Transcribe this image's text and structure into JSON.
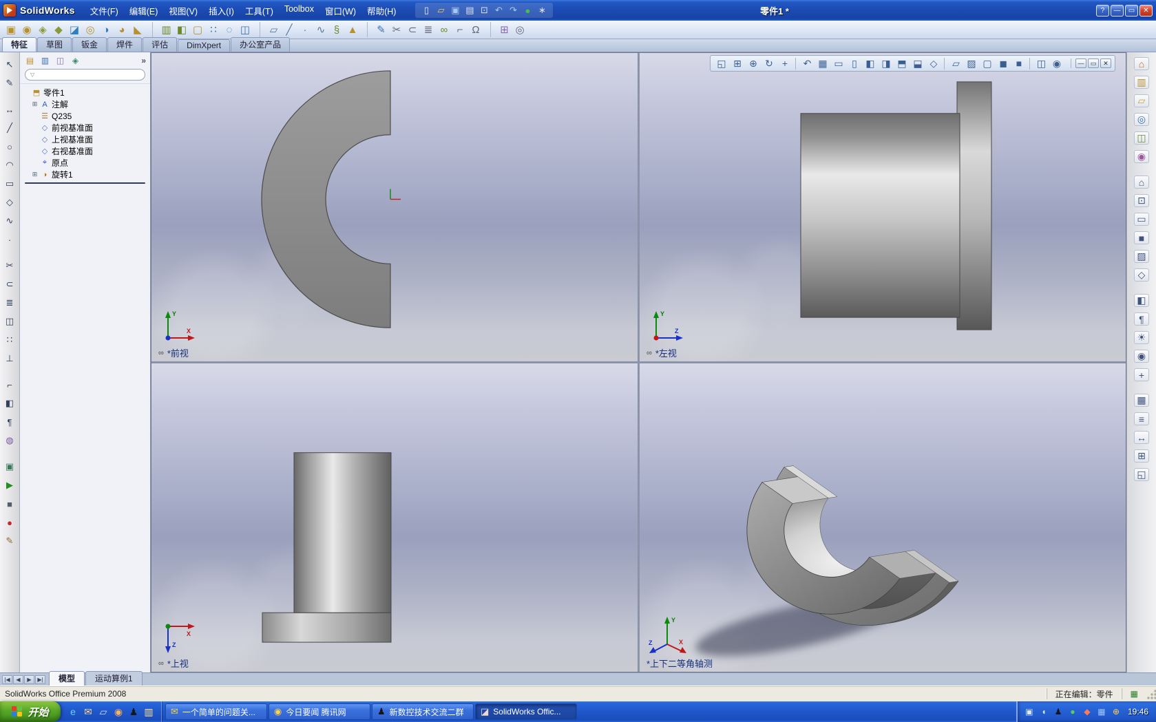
{
  "titlebar": {
    "app_name": "SolidWorks",
    "doc_title": "零件1 *",
    "help_btn": "?",
    "min_btn": "—",
    "max_btn": "▭",
    "close_btn": "✕"
  },
  "menubar": {
    "items": [
      "文件(F)",
      "编辑(E)",
      "视图(V)",
      "插入(I)",
      "工具(T)",
      "Toolbox",
      "窗口(W)",
      "帮助(H)"
    ]
  },
  "quick_icons": [
    {
      "n": "new-document-icon",
      "g": "▯",
      "c": "#eef3fc"
    },
    {
      "n": "open-document-icon",
      "g": "▱",
      "c": "#f0cc5a"
    },
    {
      "n": "save-icon",
      "g": "▣",
      "c": "#a8c8f0"
    },
    {
      "n": "print-icon",
      "g": "▤",
      "c": "#dce2f0"
    },
    {
      "n": "copy-icon",
      "g": "⊡",
      "c": "#dce2f0"
    },
    {
      "n": "undo-icon",
      "g": "↶",
      "c": "#a8c8f0"
    },
    {
      "n": "redo-icon",
      "g": "↷",
      "c": "#a8c8f0"
    },
    {
      "n": "rebuild-icon",
      "g": "●",
      "c": "#46c046"
    },
    {
      "n": "options-icon",
      "g": "∗",
      "c": "#dce2f0"
    }
  ],
  "toolbar": {
    "icons": [
      {
        "n": "extruded-boss-icon",
        "g": "▣",
        "c": "#b8912f"
      },
      {
        "n": "revolved-boss-icon",
        "g": "◉",
        "c": "#b8912f"
      },
      {
        "n": "swept-boss-icon",
        "g": "◈",
        "c": "#8a9a3a"
      },
      {
        "n": "lofted-boss-icon",
        "g": "◆",
        "c": "#8a9a3a"
      },
      {
        "n": "extruded-cut-icon",
        "g": "◪",
        "c": "#2f7fc0"
      },
      {
        "n": "hole-wizard-icon",
        "g": "◎",
        "c": "#b8912f"
      },
      {
        "n": "revolved-cut-icon",
        "g": "◑",
        "c": "#2f7fc0"
      },
      {
        "n": "fillet-icon",
        "g": "◕",
        "c": "#b8912f"
      },
      {
        "n": "chamfer-icon",
        "g": "◣",
        "c": "#b8912f"
      },
      {
        "n": "rib-icon",
        "g": "▥",
        "c": "#6a8a2a",
        "gap": true
      },
      {
        "n": "draft-icon",
        "g": "◧",
        "c": "#6a8a2a"
      },
      {
        "n": "shell-icon",
        "g": "▢",
        "c": "#b8912f"
      },
      {
        "n": "linear-pattern-icon",
        "g": "∷",
        "c": "#3a6fb0"
      },
      {
        "n": "circular-pattern-icon",
        "g": "◌",
        "c": "#3a6fb0"
      },
      {
        "n": "mirror-icon",
        "g": "◫",
        "c": "#3a6fb0"
      },
      {
        "n": "reference-plane-icon",
        "g": "▱",
        "c": "#557799",
        "gap": true
      },
      {
        "n": "axis-icon",
        "g": "╱",
        "c": "#557799"
      },
      {
        "n": "point-icon",
        "g": "·",
        "c": "#557799"
      },
      {
        "n": "curve-icon",
        "g": "∿",
        "c": "#557799"
      },
      {
        "n": "helix-icon",
        "g": "§",
        "c": "#6a8a2a"
      },
      {
        "n": "instant3d-icon",
        "g": "▲",
        "c": "#b8912f"
      },
      {
        "n": "sketch-icon",
        "g": "✎",
        "c": "#3a6fb0",
        "gap": true
      },
      {
        "n": "trim-icon",
        "g": "✂",
        "c": "#667"
      },
      {
        "n": "convert-entities-icon",
        "g": "⊂",
        "c": "#667"
      },
      {
        "n": "offset-entities-icon",
        "g": "≣",
        "c": "#667"
      },
      {
        "n": "mate-icon",
        "g": "∞",
        "c": "#6a8a2a"
      },
      {
        "n": "measure-icon",
        "g": "⌐",
        "c": "#667"
      },
      {
        "n": "mass-properties-icon",
        "g": "Ω",
        "c": "#667"
      },
      {
        "n": "toolbox-icon",
        "g": "⊞",
        "c": "#8a6aae",
        "gap": true
      },
      {
        "n": "search-icon",
        "g": "◎",
        "c": "#667"
      }
    ]
  },
  "command_tabs": {
    "items": [
      "特征",
      "草图",
      "钣金",
      "焊件",
      "评估",
      "DimXpert",
      "办公室产品"
    ]
  },
  "left_rail": [
    {
      "n": "select-arrow-icon",
      "g": "↖",
      "c": "#33415c"
    },
    {
      "n": "sketch-pencil-icon",
      "g": "✎",
      "c": "#33415c"
    },
    {
      "n": "dimension-icon",
      "g": "↔",
      "c": "#33415c",
      "gap": true
    },
    {
      "n": "line-icon",
      "g": "╱",
      "c": "#33415c"
    },
    {
      "n": "circle-icon",
      "g": "○",
      "c": "#33415c"
    },
    {
      "n": "arc-icon",
      "g": "◠",
      "c": "#33415c"
    },
    {
      "n": "rectangle-icon",
      "g": "▭",
      "c": "#33415c"
    },
    {
      "n": "polygon-icon",
      "g": "◇",
      "c": "#33415c"
    },
    {
      "n": "spline-icon",
      "g": "∿",
      "c": "#33415c"
    },
    {
      "n": "point-sketch-icon",
      "g": "·",
      "c": "#33415c"
    },
    {
      "n": "trim-entities-icon",
      "g": "✂",
      "c": "#33415c",
      "gap": true
    },
    {
      "n": "convert-icon",
      "g": "⊂",
      "c": "#33415c"
    },
    {
      "n": "offset-icon",
      "g": "≣",
      "c": "#33415c"
    },
    {
      "n": "mirror-sketch-icon",
      "g": "◫",
      "c": "#33415c"
    },
    {
      "n": "pattern-sketch-icon",
      "g": "∷",
      "c": "#33415c"
    },
    {
      "n": "relations-icon",
      "g": "⊥",
      "c": "#33415c"
    },
    {
      "n": "measure-tool-icon",
      "g": "⌐",
      "c": "#33415c",
      "gap": true
    },
    {
      "n": "section-tool-icon",
      "g": "◧",
      "c": "#33415c"
    },
    {
      "n": "annotation-icon",
      "g": "¶",
      "c": "#33415c"
    },
    {
      "n": "appearance-icon",
      "g": "◍",
      "c": "#7a5aa0"
    },
    {
      "n": "scene-icon",
      "g": "▣",
      "c": "#3a7a5a",
      "gap": true
    },
    {
      "n": "play-icon",
      "g": "▶",
      "c": "#1f8f1f"
    },
    {
      "n": "stop-icon",
      "g": "■",
      "c": "#555e6e"
    },
    {
      "n": "record-icon",
      "g": "●",
      "c": "#c22828"
    },
    {
      "n": "edit-feature-icon",
      "g": "✎",
      "c": "#8a6a2a"
    }
  ],
  "fpanel": {
    "collapse": "»",
    "filter_glyph": "▽",
    "filter_value": "",
    "tabs": [
      {
        "n": "featuremanager-tree-icon",
        "g": "▤",
        "c": "#b8912f"
      },
      {
        "n": "propertymanager-icon",
        "g": "▥",
        "c": "#3a6fb0"
      },
      {
        "n": "configurationmanager-icon",
        "g": "◫",
        "c": "#8a6aae"
      },
      {
        "n": "dimxpertmanager-icon",
        "g": "◈",
        "c": "#3a8a6a"
      }
    ]
  },
  "feature_tree": {
    "root": {
      "label": "零件1",
      "glyph": "⬒",
      "color": "#b8912f",
      "expand": ""
    },
    "items": [
      {
        "label": "注解",
        "glyph": "A",
        "color": "#1f5fbf",
        "expand": "⊞"
      },
      {
        "label": "Q235",
        "glyph": "☰",
        "color": "#9a7b2d",
        "expand": ""
      },
      {
        "label": "前视基准面",
        "glyph": "◇",
        "color": "#5577bb",
        "expand": ""
      },
      {
        "label": "上视基准面",
        "glyph": "◇",
        "color": "#5577bb",
        "expand": ""
      },
      {
        "label": "右视基准面",
        "glyph": "◇",
        "color": "#5577bb",
        "expand": ""
      },
      {
        "label": "原点",
        "glyph": "⌖",
        "color": "#2b4fd0",
        "expand": ""
      },
      {
        "label": "旋转1",
        "glyph": "◑",
        "color": "#c07820",
        "expand": "⊞"
      }
    ]
  },
  "viewports": {
    "label_icon": "∞",
    "front": {
      "label": "*前视"
    },
    "left": {
      "label": "*左视"
    },
    "top": {
      "label": "*上视"
    },
    "iso": {
      "label": "*上下二等角轴测"
    }
  },
  "axes": {
    "x": "X",
    "y": "Y",
    "z": "Z"
  },
  "view_toolbar": {
    "icons": [
      {
        "n": "zoom-to-fit-icon",
        "g": "◱"
      },
      {
        "n": "zoom-area-icon",
        "g": "⊞"
      },
      {
        "n": "zoom-in-out-icon",
        "g": "⊕"
      },
      {
        "n": "rotate-view-icon",
        "g": "↻"
      },
      {
        "n": "pan-icon",
        "g": "+"
      },
      {
        "n": "previous-view-icon",
        "g": "↶",
        "sep": true
      },
      {
        "n": "view-orientation-icon",
        "g": "▦"
      },
      {
        "n": "front-view-icon",
        "g": "▭"
      },
      {
        "n": "back-view-icon",
        "g": "▯"
      },
      {
        "n": "left-view-icon",
        "g": "◧"
      },
      {
        "n": "right-view-icon",
        "g": "◨"
      },
      {
        "n": "top-view-icon",
        "g": "⬒"
      },
      {
        "n": "bottom-view-icon",
        "g": "⬓"
      },
      {
        "n": "isometric-view-icon",
        "g": "◇"
      },
      {
        "n": "wireframe-icon",
        "g": "▱",
        "sep": true
      },
      {
        "n": "hidden-lines-visible-icon",
        "g": "▨"
      },
      {
        "n": "hidden-lines-removed-icon",
        "g": "▢"
      },
      {
        "n": "shaded-with-edges-icon",
        "g": "◼"
      },
      {
        "n": "shaded-icon",
        "g": "■"
      },
      {
        "n": "section-view-icon",
        "g": "◫",
        "sep": true
      },
      {
        "n": "camera-view-icon",
        "g": "◉"
      }
    ],
    "win": {
      "min": "—",
      "restore": "▭",
      "close": "✕"
    }
  },
  "right_rail": [
    {
      "n": "solidworks-resources-icon",
      "g": "⌂",
      "c": "#c06a1e"
    },
    {
      "n": "design-library-icon",
      "g": "▥",
      "c": "#b8912f"
    },
    {
      "n": "file-explorer-icon",
      "g": "▱",
      "c": "#caa23a"
    },
    {
      "n": "search-pane-icon",
      "g": "◎",
      "c": "#3a6fae"
    },
    {
      "n": "view-palette-icon",
      "g": "◫",
      "c": "#6a8a3a"
    },
    {
      "n": "appearances-pane-icon",
      "g": "◉",
      "c": "#a0569a"
    },
    {
      "n": "home-view-icon",
      "g": "⌂",
      "c": "#41537a",
      "gap": true
    },
    {
      "n": "zoom-fit-pane-icon",
      "g": "⊡",
      "c": "#41537a"
    },
    {
      "n": "wireframe-pane-icon",
      "g": "▭",
      "c": "#41537a"
    },
    {
      "n": "shaded-pane-icon",
      "g": "■",
      "c": "#41537a"
    },
    {
      "n": "hidden-lines-pane-icon",
      "g": "▨",
      "c": "#41537a"
    },
    {
      "n": "perspective-pane-icon",
      "g": "◇",
      "c": "#41537a"
    },
    {
      "n": "section-pane-icon",
      "g": "◧",
      "c": "#41537a",
      "gap": true
    },
    {
      "n": "annotations-pane-icon",
      "g": "¶",
      "c": "#41537a"
    },
    {
      "n": "lights-pane-icon",
      "g": "☀",
      "c": "#41537a"
    },
    {
      "n": "cameras-pane-icon",
      "g": "◉",
      "c": "#41537a"
    },
    {
      "n": "axes-pane-icon",
      "g": "+",
      "c": "#41537a"
    },
    {
      "n": "grid-pane-icon",
      "g": "▦",
      "c": "#41537a",
      "gap": true
    },
    {
      "n": "units-pane-icon",
      "g": "≡",
      "c": "#41537a"
    },
    {
      "n": "dimension-pane-icon",
      "g": "↔",
      "c": "#41537a"
    },
    {
      "n": "snap-pane-icon",
      "g": "⊞",
      "c": "#41537a"
    },
    {
      "n": "fullscreen-pane-icon",
      "g": "◱",
      "c": "#41537a"
    }
  ],
  "model_tabs": {
    "nav": [
      "|◀",
      "◀",
      "▶",
      "▶|"
    ],
    "items": [
      "模型",
      "运动算例1"
    ]
  },
  "status_bar": {
    "left": "SolidWorks Office Premium 2008",
    "editing": "正在编辑：零件",
    "grid_glyph": "▦"
  },
  "taskbar": {
    "start_label": "开始",
    "quick_launch": [
      {
        "n": "internet-explorer-icon",
        "g": "e",
        "c": "#6ad0ff"
      },
      {
        "n": "outlook-icon",
        "g": "✉",
        "c": "#ffd890"
      },
      {
        "n": "show-desktop-icon",
        "g": "▱",
        "c": "#cfe0f8"
      },
      {
        "n": "media-player-icon",
        "g": "◉",
        "c": "#ffb060"
      },
      {
        "n": "qq-icon",
        "g": "♟",
        "c": "#101820"
      },
      {
        "n": "folder-icon",
        "g": "▥",
        "c": "#ffe08a"
      }
    ],
    "tasks": [
      {
        "n": "task-question",
        "g": "✉",
        "c": "#f5d34a",
        "label": "一个简单的问题关..."
      },
      {
        "n": "task-tencent-news",
        "g": "◉",
        "c": "#ffd24a",
        "label": "今日要闻 腾讯网"
      },
      {
        "n": "task-qq-group",
        "g": "♟",
        "c": "#14141e",
        "label": "新数控技术交流二群"
      },
      {
        "n": "task-solidworks",
        "g": "◪",
        "c": "#f0d8d0",
        "label": "SolidWorks Offic..."
      }
    ],
    "tray_icons": [
      {
        "n": "input-method-icon",
        "g": "▣",
        "c": "#d8e6ff"
      },
      {
        "n": "volume-icon",
        "g": "◖",
        "c": "#d8e6ff"
      },
      {
        "n": "qq-tray-icon",
        "g": "♟",
        "c": "#14141e"
      },
      {
        "n": "messenger-icon",
        "g": "●",
        "c": "#58d058"
      },
      {
        "n": "antivirus-icon",
        "g": "◆",
        "c": "#ff7a5a"
      },
      {
        "n": "network-icon",
        "g": "▦",
        "c": "#9ac4ff"
      },
      {
        "n": "update-icon",
        "g": "⊕",
        "c": "#ffd24a"
      }
    ],
    "time": "19:46"
  }
}
